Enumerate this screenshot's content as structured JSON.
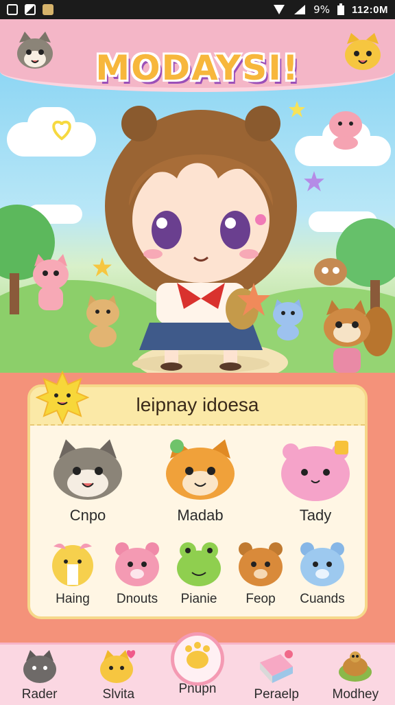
{
  "status_bar": {
    "battery_signal_text": "9%",
    "time": "112:0M"
  },
  "app": {
    "title": "MODAYSI!"
  },
  "panel": {
    "title": "leipnay idoesa",
    "pets_top": [
      {
        "label": "Cnpo",
        "icon": "gray-cat-icon",
        "color": "#8b8478"
      },
      {
        "label": "Madab",
        "icon": "orange-fox-icon",
        "color": "#f0a13a"
      },
      {
        "label": "Tady",
        "icon": "pink-blob-icon",
        "color": "#f5a3c9"
      }
    ],
    "pets_bottom": [
      {
        "label": "Haing",
        "icon": "yellow-bunny-icon",
        "color": "#f6d04d"
      },
      {
        "label": "Dnouts",
        "icon": "pink-bear-icon",
        "color": "#f49ab3"
      },
      {
        "label": "Pianie",
        "icon": "green-frog-icon",
        "color": "#8fcf4f"
      },
      {
        "label": "Feop",
        "icon": "brown-bear-icon",
        "color": "#d98a3a"
      },
      {
        "label": "Cuands",
        "icon": "blue-bear-icon",
        "color": "#9dc9ef"
      }
    ]
  },
  "bottom_nav": [
    {
      "label": "Rader",
      "icon": "gray-cat-icon"
    },
    {
      "label": "Slvita",
      "icon": "yellow-cat-icon"
    },
    {
      "label": "Pnupn",
      "icon": "paw-icon",
      "active": true
    },
    {
      "label": "Peraelp",
      "icon": "book-icon"
    },
    {
      "label": "Modhey",
      "icon": "turtle-icon"
    }
  ],
  "colors": {
    "header_pink": "#f4b6c7",
    "panel_bg": "#f4927a",
    "panel_card": "#fff6e4",
    "accent_yellow": "#fbe9a7"
  }
}
